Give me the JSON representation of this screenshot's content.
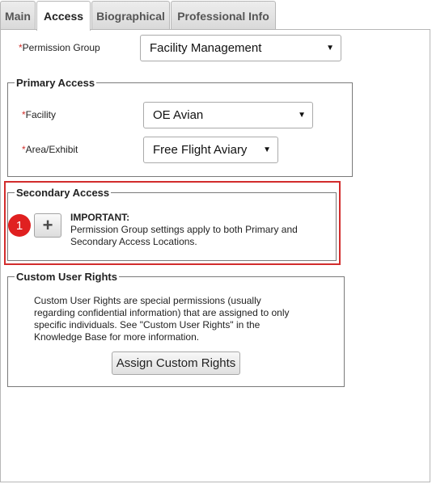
{
  "tabs": [
    {
      "label": "Main"
    },
    {
      "label": "Access"
    },
    {
      "label": "Biographical"
    },
    {
      "label": "Professional Info"
    }
  ],
  "required_marker": "*",
  "permission_group": {
    "label": "Permission Group",
    "value": "Facility Management"
  },
  "primary_access": {
    "legend": "Primary Access",
    "facility": {
      "label": "Facility",
      "value": "OE Avian"
    },
    "area": {
      "label": "Area/Exhibit",
      "value": "Free Flight Aviary"
    }
  },
  "secondary_access": {
    "legend": "Secondary Access",
    "badge": "1",
    "add_icon": "plus-icon",
    "important_title": "IMPORTANT:",
    "important_text": "Permission Group settings apply to both Primary and Secondary Access Locations."
  },
  "custom_rights": {
    "legend": "Custom User Rights",
    "description": "Custom User Rights are special permissions (usually regarding confidential information) that are assigned to only specific individuals. See \"Custom User Rights\" in the Knowledge Base for more information.",
    "button_label": "Assign Custom Rights"
  },
  "colors": {
    "required": "#d0312d",
    "highlight": "#d22c2c",
    "badge": "#e02020"
  }
}
